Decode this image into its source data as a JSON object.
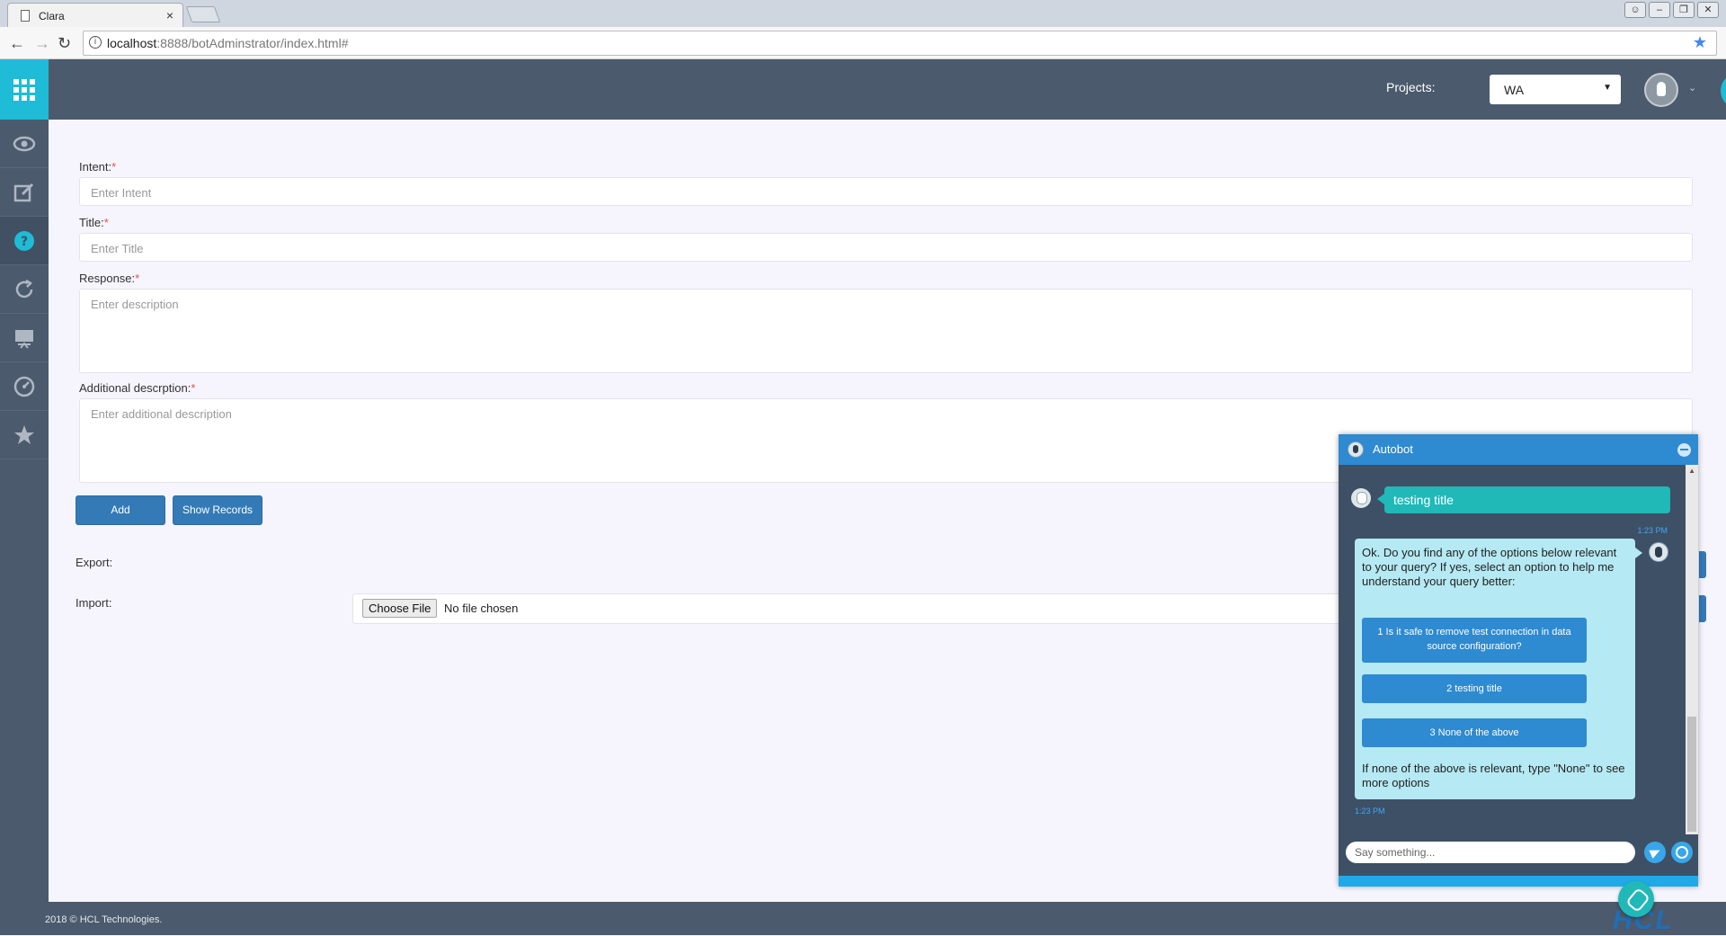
{
  "browser": {
    "tab_title": "Clara",
    "tab_close": "×",
    "url_host": "localhost",
    "url_path": ":8888/botAdminstrator/index.html#"
  },
  "topbar": {
    "projects_label": "Projects:",
    "project_selected": "WA"
  },
  "sidebar": {
    "items": [
      {
        "icon": "eye-icon"
      },
      {
        "icon": "edit-icon"
      },
      {
        "icon": "help-icon"
      },
      {
        "icon": "refresh-icon"
      },
      {
        "icon": "presentation-icon"
      },
      {
        "icon": "dashboard-icon"
      },
      {
        "icon": "star-icon"
      }
    ]
  },
  "form": {
    "intent_label": "Intent:",
    "intent_placeholder": "Enter Intent",
    "title_label": "Title:",
    "title_placeholder": "Enter Title",
    "response_label": "Response:",
    "response_placeholder": "Enter description",
    "additional_label": "Additional descrption:",
    "additional_placeholder": "Enter additional description",
    "required_mark": "*",
    "add_button": "Add",
    "show_records_button": "Show Records",
    "export_label": "Export:",
    "import_label": "Import:",
    "choose_file_button": "Choose File",
    "no_file_text": "No file chosen"
  },
  "footer": {
    "copyright": "2018 © HCL Technologies.",
    "logo_text": "HCL"
  },
  "chat": {
    "title": "Autobot",
    "user_message": "testing title",
    "user_time": "1:23 PM",
    "bot_intro": "Ok. Do you find any of the options below relevant to your query? If yes, select an option to help me understand your query better:",
    "options": [
      "1 Is it safe to remove test connection in data source configuration?",
      "2 testing title",
      "3 None of the above"
    ],
    "bot_outro": "If none of the above is relevant, type \"None\" to see more options",
    "bot_time": "1:23 PM",
    "input_placeholder": "Say something..."
  },
  "colors": {
    "accent": "#1ebcd6",
    "sidebar_bg": "#4b5a6d",
    "primary_button": "#337ab7",
    "chat_header": "#2e8ad1",
    "user_bubble": "#21b8b8",
    "bot_bubble": "#b5e9f3"
  }
}
